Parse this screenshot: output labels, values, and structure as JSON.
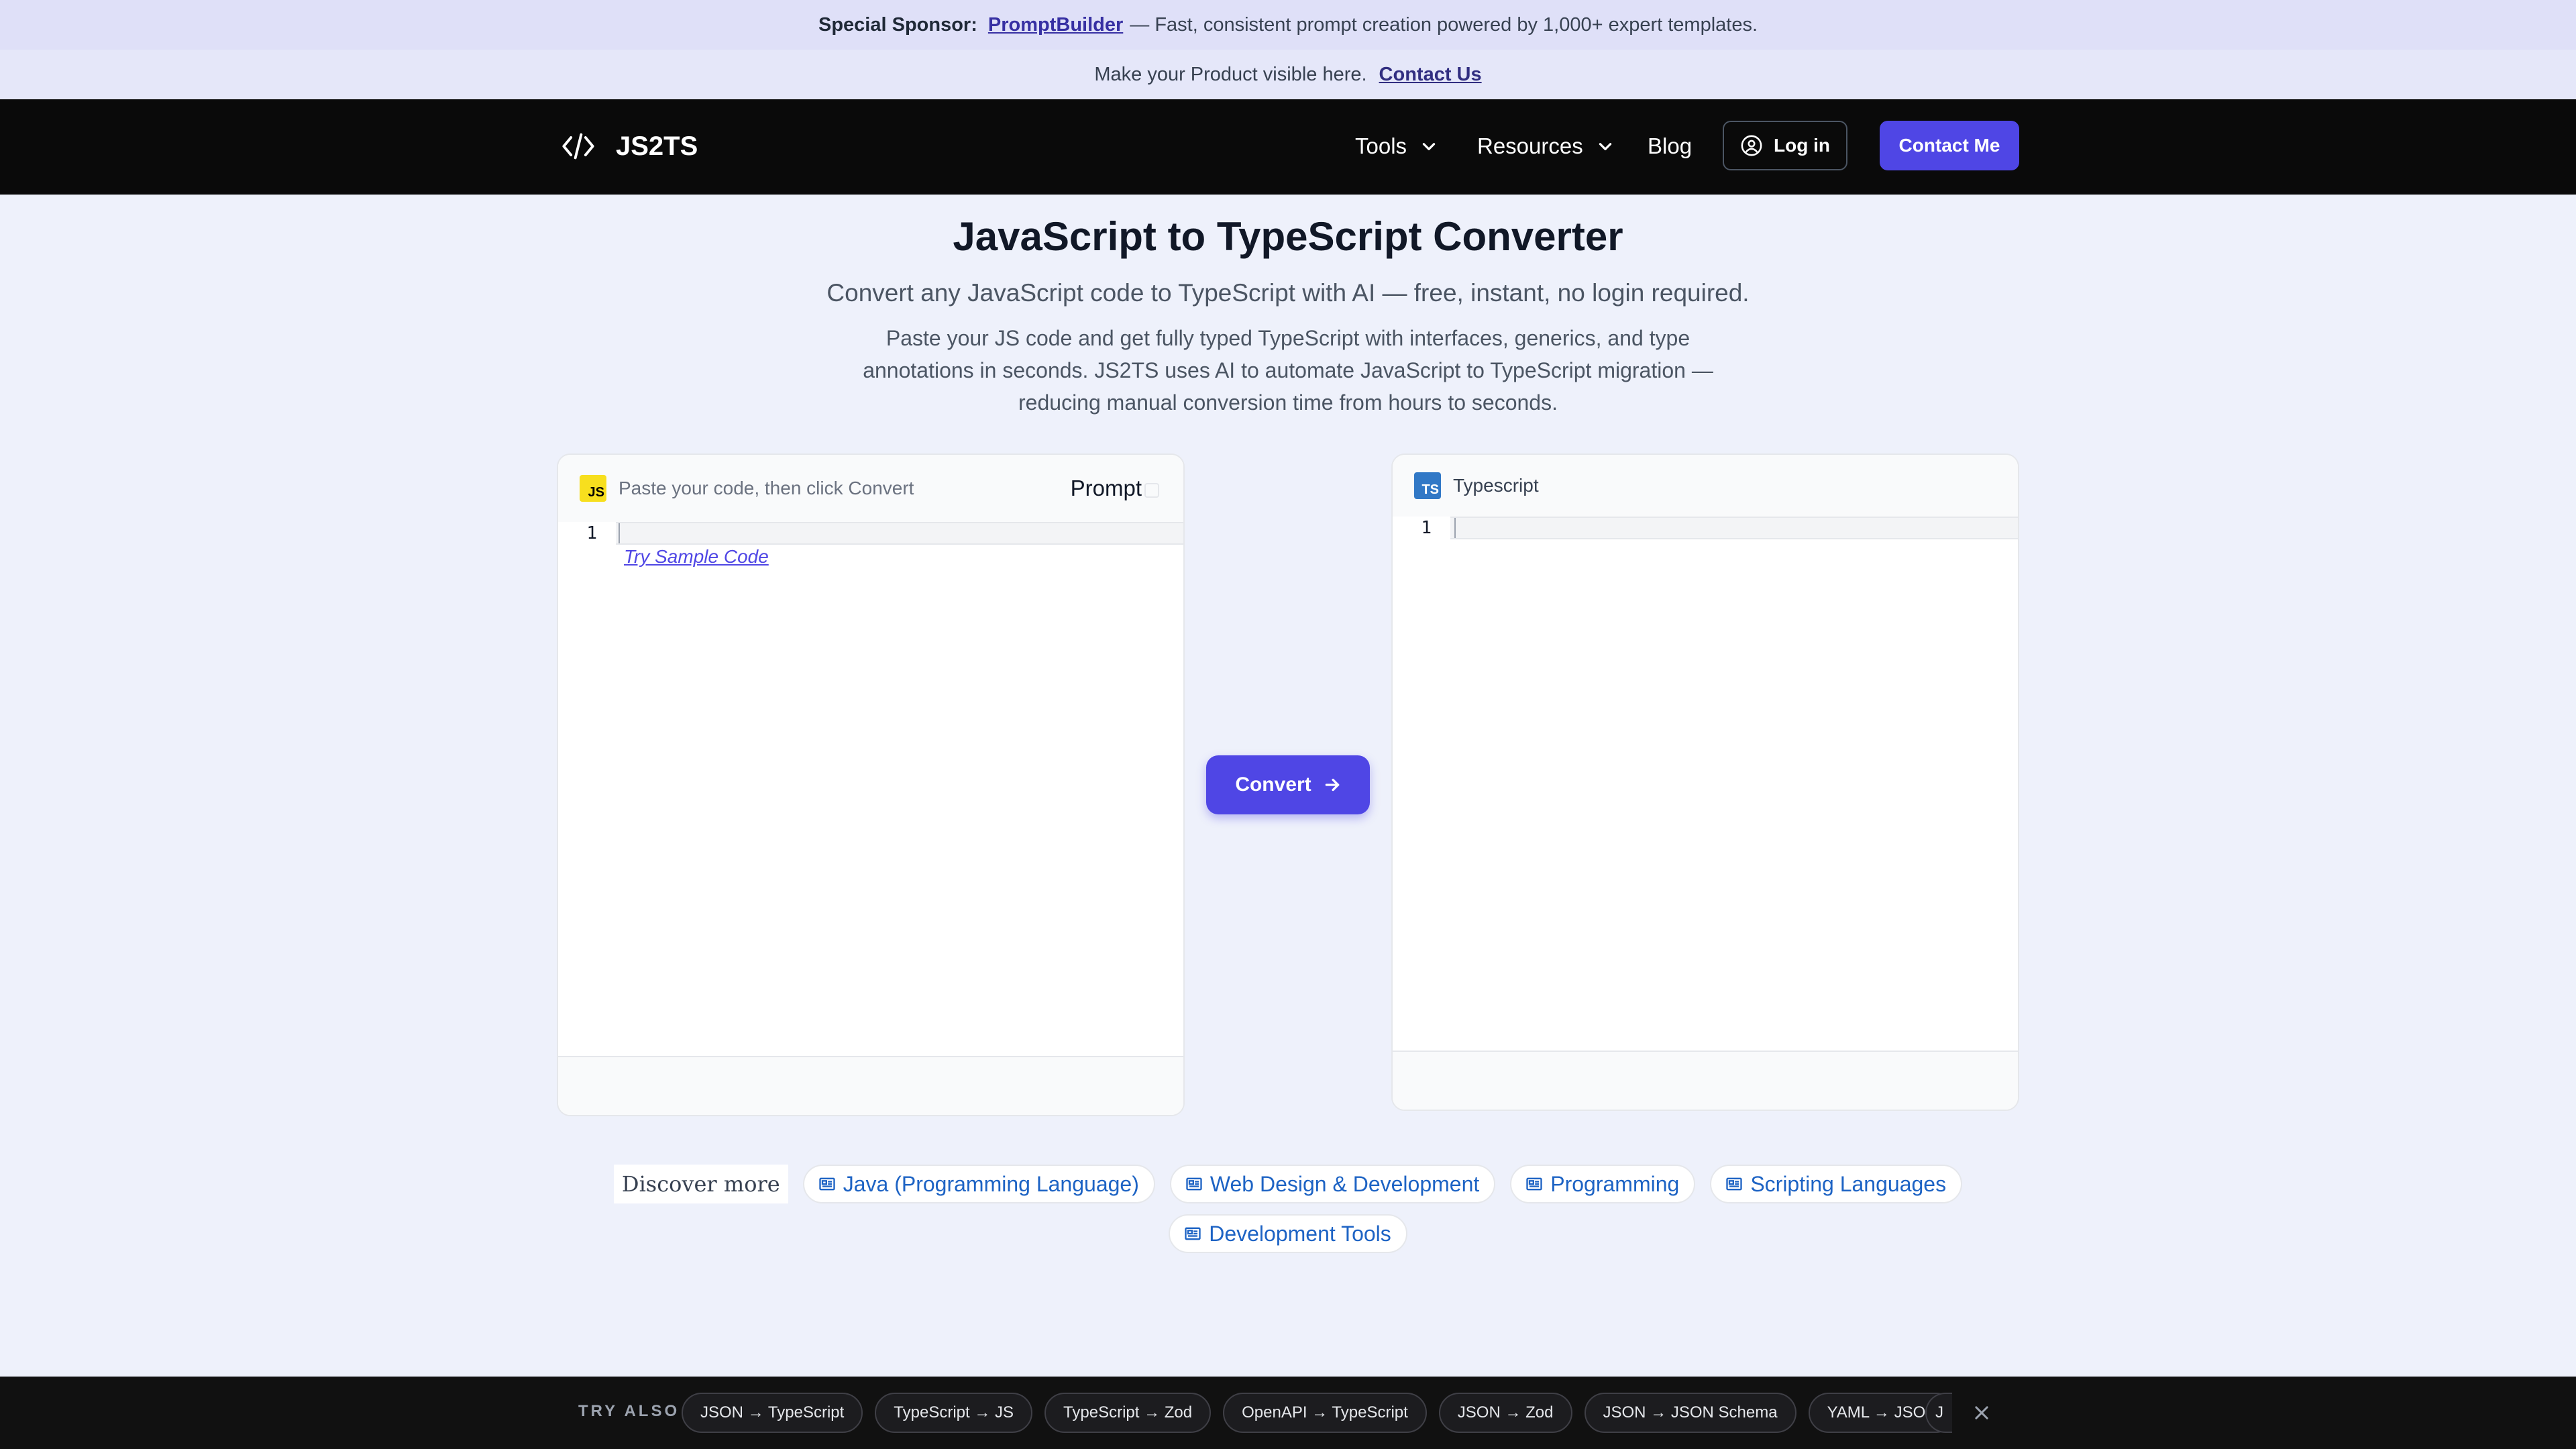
{
  "sponsor": {
    "label": "Special Sponsor:",
    "link": "PromptBuilder",
    "text": "— Fast, consistent prompt creation powered by 1,000+ expert templates."
  },
  "promo": {
    "text": "Make your Product visible here.",
    "link": "Contact Us"
  },
  "nav": {
    "brand": "JS2TS",
    "tools": "Tools",
    "resources": "Resources",
    "blog": "Blog",
    "login": "Log in",
    "contact": "Contact Me"
  },
  "hero": {
    "title": "JavaScript to TypeScript Converter",
    "subtitle": "Convert any JavaScript code to TypeScript with AI — free, instant, no login required.",
    "desc_lines": [
      "Paste your JS code and get fully typed TypeScript with interfaces, generics, and type",
      "annotations in seconds. JS2TS uses AI to automate JavaScript to TypeScript migration —",
      "reducing manual conversion time from hours to seconds."
    ]
  },
  "input_panel": {
    "badge": "JS",
    "placeholder": "Paste your code, then click Convert",
    "prompt_label": "Prompt",
    "line_number": "1",
    "sample_link": "Try Sample Code"
  },
  "output_panel": {
    "badge": "TS",
    "title": "Typescript",
    "line_number": "1"
  },
  "convert": {
    "label": "Convert"
  },
  "discover": {
    "label": "Discover more",
    "chips": [
      "Java (Programming Language)",
      "Web Design & Development",
      "Programming",
      "Scripting Languages",
      "Development Tools"
    ]
  },
  "try_also": {
    "label": "TRY ALSO",
    "items": [
      "JSON → TypeScript",
      "TypeScript → JS",
      "TypeScript → Zod",
      "OpenAPI → TypeScript",
      "JSON → Zod",
      "JSON → JSON Schema",
      "YAML → JSON"
    ],
    "more": "J"
  },
  "colors": {
    "accent": "#4f46e5",
    "nav_bg": "#0a0a0a",
    "page_bg": "#eef1fb",
    "chip_text": "#1d63c4"
  }
}
